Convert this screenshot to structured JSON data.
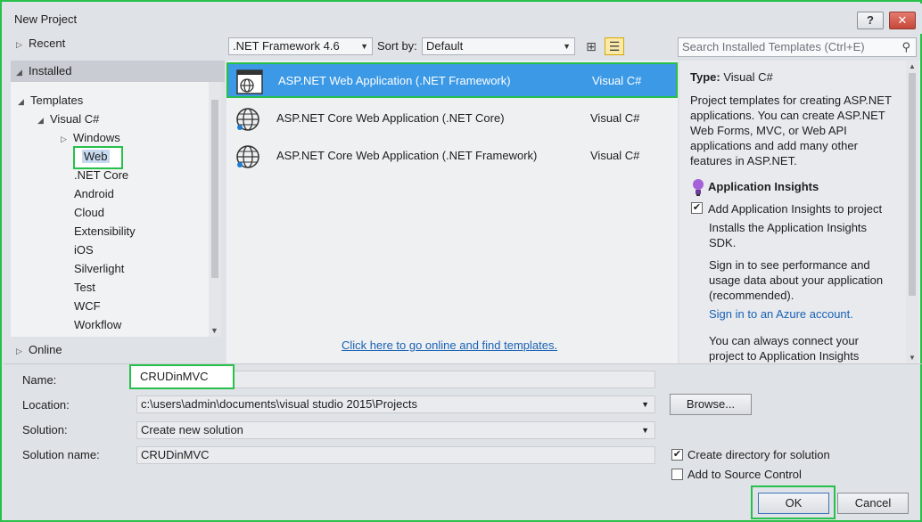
{
  "window": {
    "title": "New Project",
    "help_label": "?",
    "close_label": "✕"
  },
  "left_pane": {
    "recent": "Recent",
    "installed": "Installed",
    "templates": "Templates",
    "visual_csharp": "Visual C#",
    "items": [
      "Windows",
      "Web",
      ".NET Core",
      "Android",
      "Cloud",
      "Extensibility",
      "iOS",
      "Silverlight",
      "Test",
      "WCF",
      "Workflow"
    ],
    "online": "Online"
  },
  "toolbar": {
    "framework": ".NET Framework 4.6",
    "sort_by_label": "Sort by:",
    "sort_value": "Default",
    "search_placeholder": "Search Installed Templates (Ctrl+E)"
  },
  "templates": [
    {
      "name": "ASP.NET Web Application (.NET Framework)",
      "lang": "Visual C#"
    },
    {
      "name": "ASP.NET Core Web Application (.NET Core)",
      "lang": "Visual C#"
    },
    {
      "name": "ASP.NET Core Web Application (.NET Framework)",
      "lang": "Visual C#"
    }
  ],
  "online_link": "Click here to go online and find templates.",
  "details": {
    "type_label": "Type:",
    "type_value": "Visual C#",
    "description": [
      "Project templates for creating ASP.NET",
      "applications. You can create ASP.NET",
      "Web Forms, MVC, or Web API",
      "applications and add many other",
      "features in ASP.NET."
    ],
    "insights_title": "Application Insights",
    "add_insights": "Add Application Insights to project",
    "installs": [
      "Installs the Application Insights",
      "SDK."
    ],
    "sign_in_text": [
      "Sign in to see performance and",
      "usage data about your application",
      "(recommended)."
    ],
    "sign_in_link": "Sign in to an Azure account.",
    "connect_text": [
      "You can always connect your",
      "project to Application Insights"
    ]
  },
  "form": {
    "name_label": "Name:",
    "name_value": "CRUDinMVC",
    "location_label": "Location:",
    "location_value": "c:\\users\\admin\\documents\\visual studio 2015\\Projects",
    "solution_label": "Solution:",
    "solution_value": "Create new solution",
    "solution_name_label": "Solution name:",
    "solution_name_value": "CRUDinMVC",
    "browse": "Browse...",
    "create_dir": "Create directory for solution",
    "source_control": "Add to Source Control",
    "ok": "OK",
    "cancel": "Cancel"
  }
}
